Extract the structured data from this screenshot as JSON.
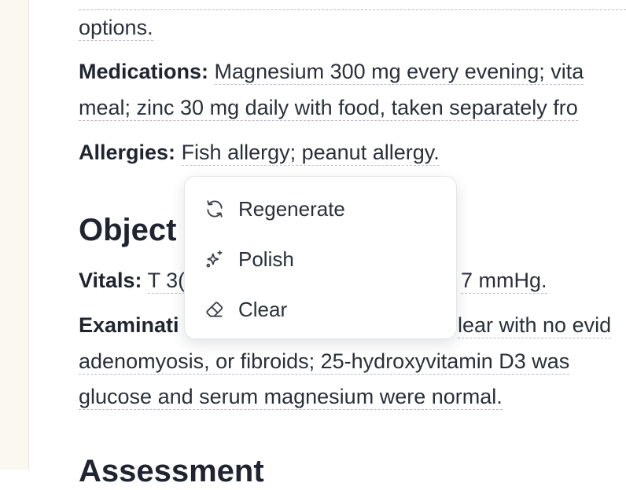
{
  "note": {
    "options_text": "options.",
    "medications_label": "Medications:",
    "medications_line1": "Magnesium 300 mg every evening; vita",
    "medications_line2": "meal; zinc 30 mg daily with food, taken separately fro",
    "allergies_label": "Allergies:",
    "allergies_text": "Fish allergy; peanut allergy.",
    "objective_heading": "Object",
    "vitals_label": "Vitals:",
    "vitals_left": "T 3(",
    "vitals_right": "7 mmHg.",
    "exam_label": "Examinati",
    "exam_right": "lear with no evid",
    "exam_line2": "adenomyosis, or fibroids; 25-hydroxyvitamin D3 was",
    "exam_line3": "glucose and serum magnesium were normal.",
    "assessment_heading": "Assessment"
  },
  "menu": {
    "items": [
      {
        "label": "Regenerate",
        "icon": "refresh-icon"
      },
      {
        "label": "Polish",
        "icon": "sparkles-icon"
      },
      {
        "label": "Clear",
        "icon": "eraser-icon"
      }
    ]
  },
  "colors": {
    "text": "#2a2f3a",
    "heading": "#1f2430",
    "dashed_underline": "#b8bcc6",
    "rail_bg": "#fbf8f1",
    "popover_border": "#e3e5ea"
  }
}
